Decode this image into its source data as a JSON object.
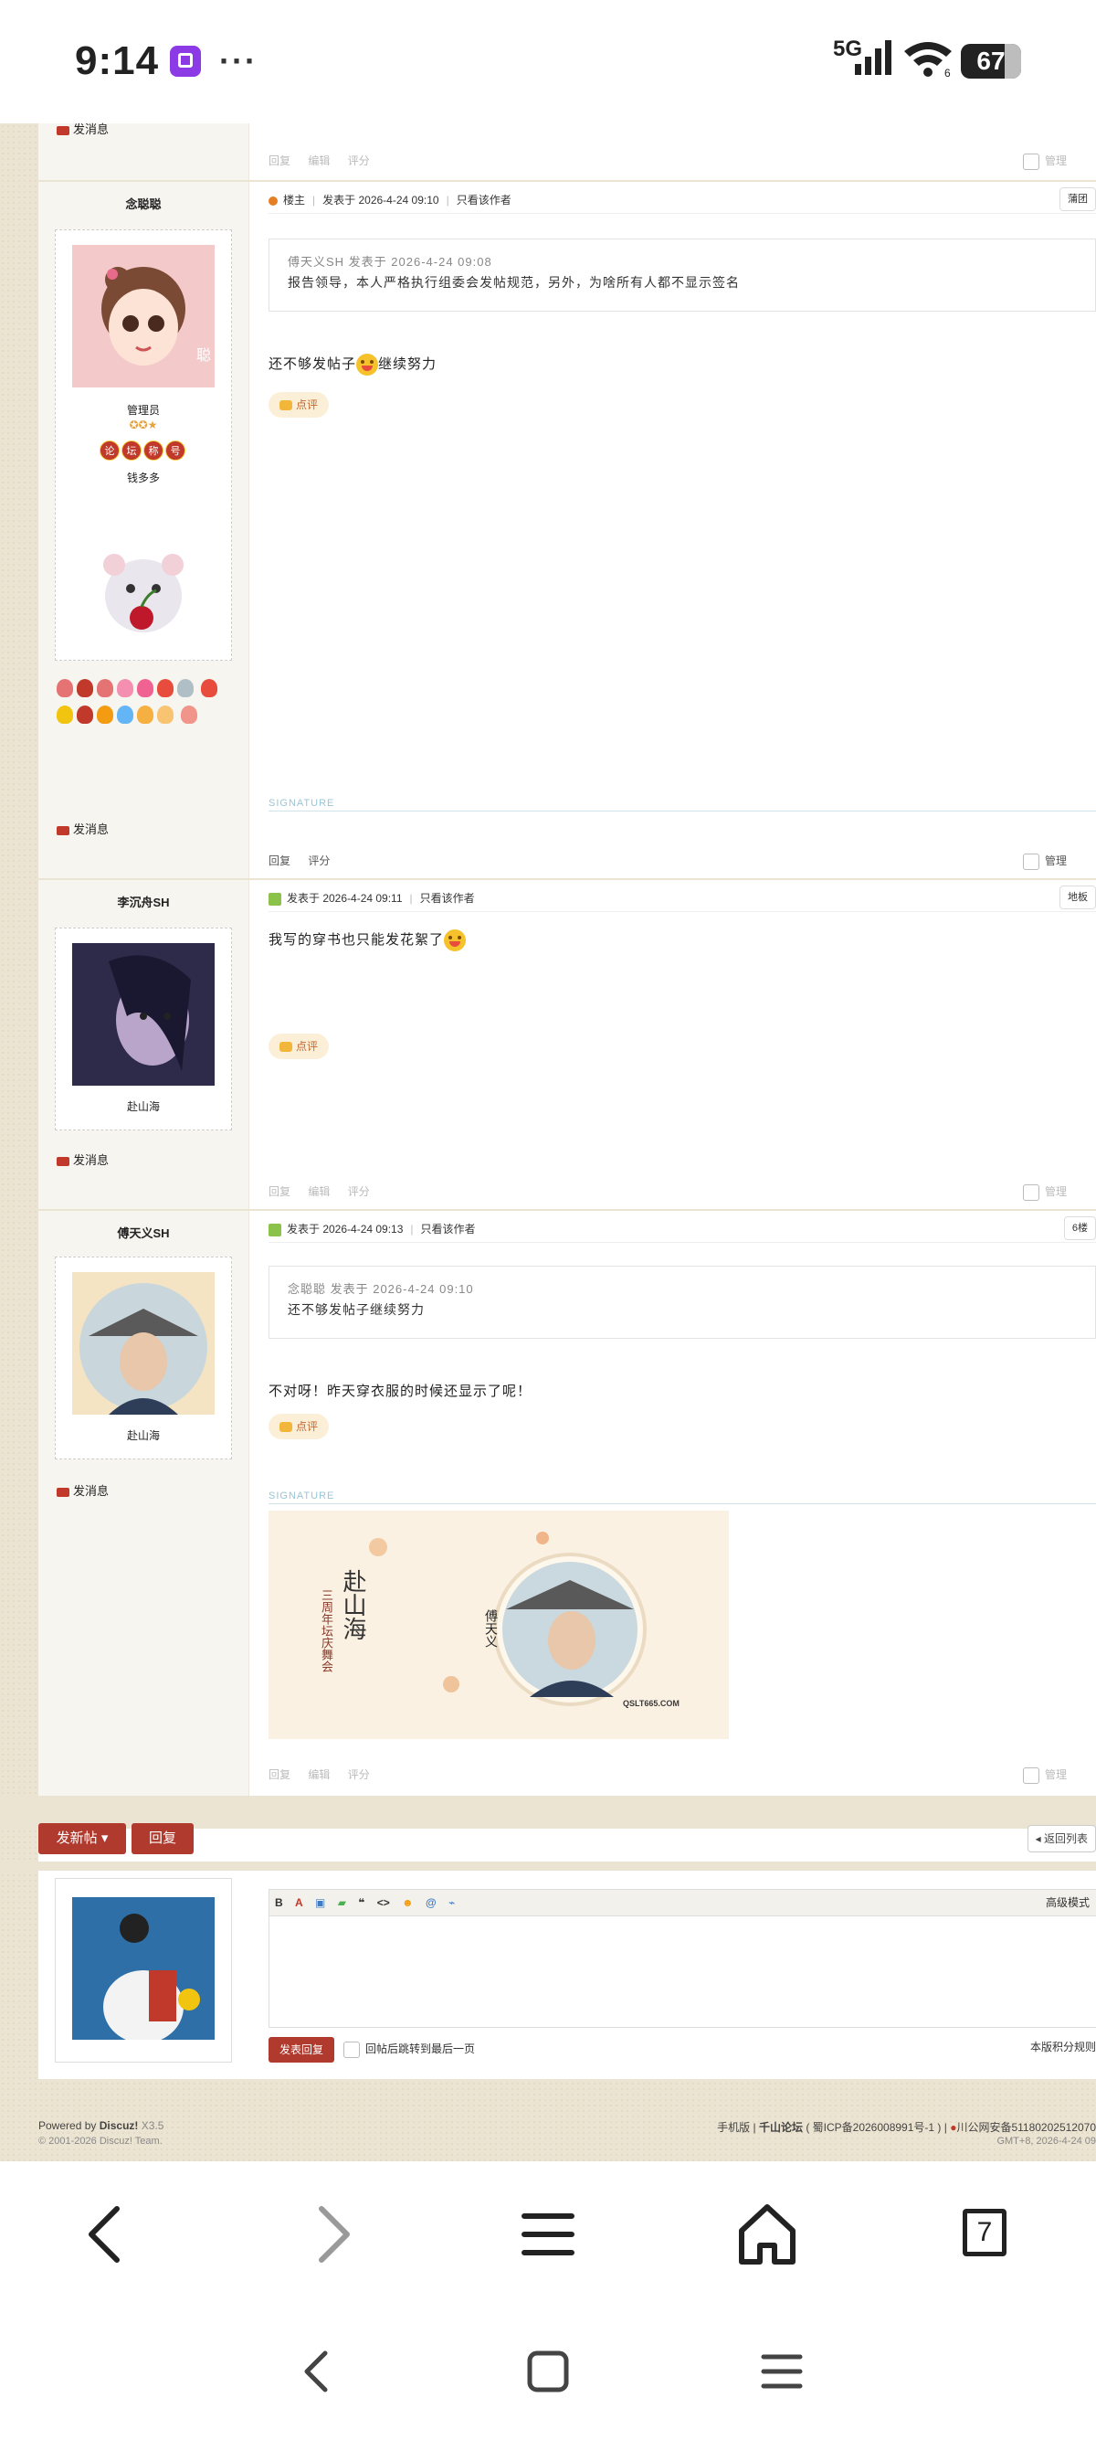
{
  "status_bar": {
    "time": "9:14",
    "network": "5G",
    "battery": "67",
    "wifi_badge": "6"
  },
  "top_post": {
    "send_message": "发消息",
    "actions": [
      "回复",
      "编辑",
      "评分"
    ],
    "manage": "管理"
  },
  "post1": {
    "username": "念聪聪",
    "role_hint": "聪",
    "role": "管理员",
    "title_badge": [
      "论",
      "坛",
      "称",
      "号"
    ],
    "money_label": "钱多多",
    "meta_owner": "楼主",
    "meta_time": "发表于 2026-4-24 09:10",
    "meta_only": "只看该作者",
    "floor": "蒲团",
    "quote_head": "傅天义SH 发表于 2026-4-24 09:08",
    "quote_body": "报告领导，本人严格执行组委会发帖规范，另外，为啥所有人都不显示签名",
    "text": "还不够发帖子",
    "text_suffix": "继续努力",
    "dianping": "点评",
    "signature": "SIGNATURE",
    "send_message": "发消息",
    "actions": [
      "回复",
      "评分"
    ],
    "manage": "管理"
  },
  "post2": {
    "username": "李沉舟SH",
    "label": "赴山海",
    "meta_time": "发表于 2026-4-24 09:11",
    "meta_only": "只看该作者",
    "floor": "地板",
    "text": "我写的穿书也只能发花絮了",
    "dianping": "点评",
    "send_message": "发消息",
    "actions": [
      "回复",
      "编辑",
      "评分"
    ],
    "manage": "管理"
  },
  "post3": {
    "username": "傅天义SH",
    "label": "赴山海",
    "meta_time": "发表于 2026-4-24 09:13",
    "meta_only": "只看该作者",
    "floor": "6楼",
    "quote_head": "念聪聪 发表于 2026-4-24 09:10",
    "quote_body": "还不够发帖子继续努力",
    "text": "不对呀！昨天穿衣服的时候还显示了呢！",
    "dianping": "点评",
    "signature": "SIGNATURE",
    "sig_title": "赴山海",
    "sig_sub": "三周年坛庆舞会",
    "sig_name": "傅天义",
    "sig_site": "QSLT665.COM",
    "send_message": "发消息",
    "actions": [
      "回复",
      "编辑",
      "评分"
    ],
    "manage": "管理"
  },
  "bottom": {
    "new_post": "发新帖",
    "reply": "回复",
    "back_list": "返回列表",
    "advanced": "高级模式",
    "submit": "发表回复",
    "jump_last": "回帖后跳转到最后一页",
    "score_rules": "本版积分规则"
  },
  "footer": {
    "powered": "Powered by",
    "discuz": "Discuz!",
    "version": "X3.5",
    "copyright": "© 2001-2026 Discuz! Team.",
    "mobile": "手机版",
    "forum_name": "千山论坛",
    "icp": "( 蜀ICP备2026008991号-1 )",
    "police": "川公网安备51180202512070",
    "gmt": "GMT+8, 2026-4-24 09"
  },
  "nav": {
    "tabs_count": "7"
  }
}
